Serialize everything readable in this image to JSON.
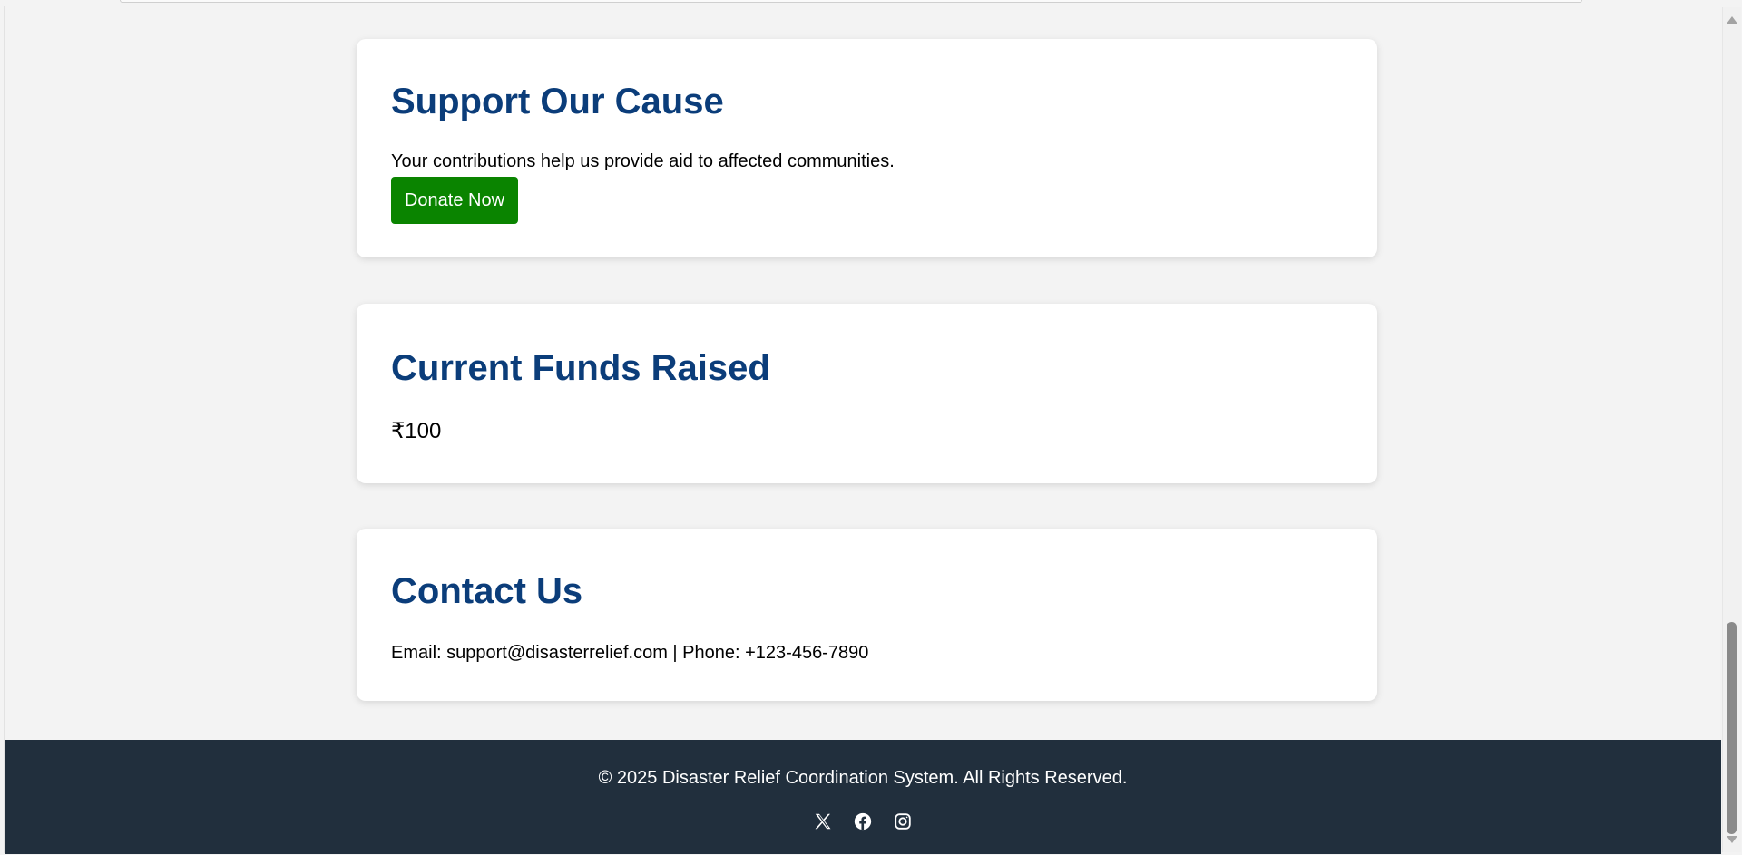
{
  "support": {
    "title": "Support Our Cause",
    "text": "Your contributions help us provide aid to affected communities.",
    "button_label": "Donate Now"
  },
  "funds": {
    "title": "Current Funds Raised",
    "amount": "₹100"
  },
  "contact": {
    "title": "Contact Us",
    "text": "Email: support@disasterrelief.com | Phone: +123-456-7890"
  },
  "footer": {
    "copyright": "© 2025 Disaster Relief Coordination System. All Rights Reserved.",
    "social_icons": [
      "x-icon",
      "facebook-icon",
      "instagram-icon"
    ]
  },
  "colors": {
    "heading": "#0b3d7a",
    "donate_button": "#0a8400",
    "footer_bg": "#212f3d",
    "page_bg": "#f3f3f3"
  }
}
